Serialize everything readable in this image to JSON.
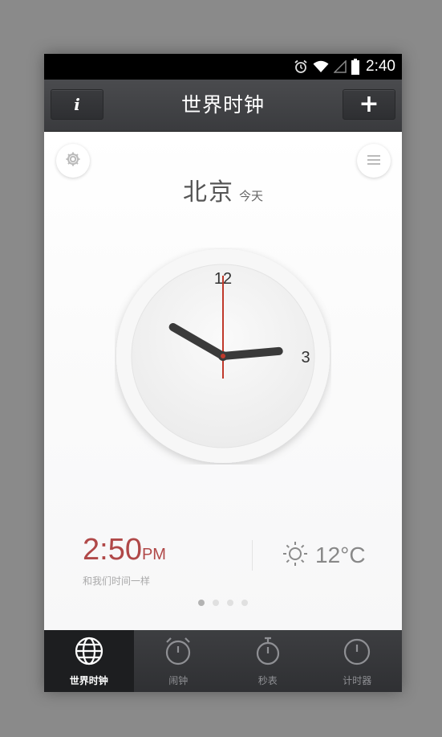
{
  "status_bar": {
    "time": "2:40",
    "icons": [
      "alarm-icon",
      "wifi-icon",
      "signal-icon",
      "battery-icon"
    ]
  },
  "title_bar": {
    "title": "世界时钟",
    "info_label": "i",
    "add_label": "+"
  },
  "city": {
    "name": "北京",
    "day": "今天"
  },
  "clock": {
    "numeral_12": "12",
    "numeral_3": "3",
    "hour": 2,
    "minute": 50,
    "second": 0,
    "second_hand_color": "#c0392b"
  },
  "digital": {
    "time": "2:50",
    "ampm": "PM",
    "subtitle": "和我们时间一样",
    "color": "#b04848"
  },
  "weather": {
    "icon": "sun-icon",
    "temperature": "12°C"
  },
  "pager": {
    "count": 4,
    "active_index": 0
  },
  "tabs": [
    {
      "label": "世界时钟",
      "icon": "globe-icon",
      "active": true
    },
    {
      "label": "闹钟",
      "icon": "alarm-clock-icon",
      "active": false
    },
    {
      "label": "秒表",
      "icon": "stopwatch-icon",
      "active": false
    },
    {
      "label": "计时器",
      "icon": "timer-icon",
      "active": false
    }
  ]
}
